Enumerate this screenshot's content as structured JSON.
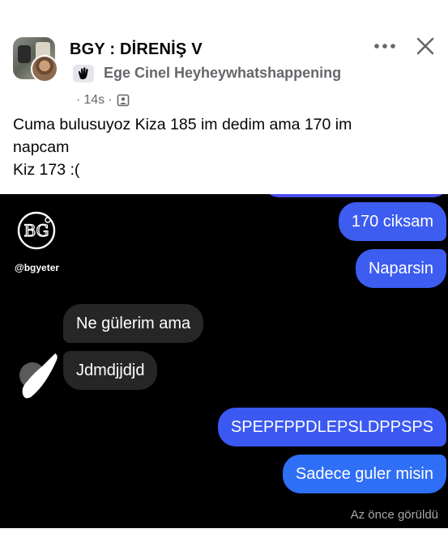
{
  "post": {
    "group_name": "BGY : DİRENİŞ V",
    "author_name": "Ege Cinel Heyheywhatshappening",
    "time": "14s",
    "body": "Cuma bulusuyoz Kiza 185 im dedim ama 170 im\nnapcam\nKiz 173 :("
  },
  "chat": {
    "watermark": "@bgyeter",
    "messages": [
      {
        "side": "out",
        "text": "170 ciksam"
      },
      {
        "side": "out",
        "text": "Naparsin"
      },
      {
        "side": "in",
        "text": "Ne gülerim ama"
      },
      {
        "side": "in",
        "text": "Jdmdjjdjd"
      },
      {
        "side": "out",
        "text": "SPEPFPPDLEPSLDPPSPS"
      },
      {
        "side": "out",
        "text": "Sadece guler misin"
      }
    ],
    "seen_status": "Az önce görüldü"
  },
  "colors": {
    "outgoing_bubble": "#3d5cf0",
    "incoming_bubble": "#262626",
    "chat_background": "#000000",
    "secondary_text": "#65676b"
  },
  "icons": {
    "more": "more-horizontal-icon",
    "close": "close-icon",
    "badge": "waving-hand-icon",
    "audience": "globe-icon"
  }
}
